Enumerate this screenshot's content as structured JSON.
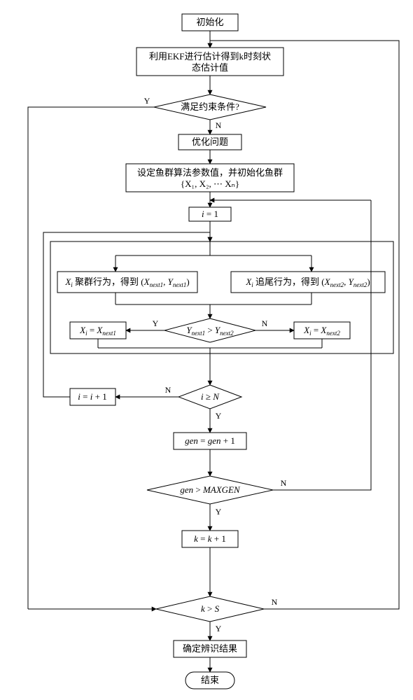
{
  "nodes": {
    "init": "初始化",
    "ekf_l1": "利用EKF进行估计得到k时刻状",
    "ekf_l2": "态估计值",
    "cond_constraint": "满足约束条件?",
    "opt": "优化问题",
    "fish_l1": "设定鱼群算法参数值，并初始化鱼群",
    "i1": "i = 1",
    "swarm_prefix": "X",
    "swarm_text": " 聚群行为，得到 ",
    "follow_text": " 追尾行为，得到 ",
    "xi_next1": "X",
    "xi_next2": "X",
    "gen_label": "gen = gen + 1",
    "gen_cond": "gen > MAXGEN",
    "k_inc": "k = k + 1",
    "k_cond": "k > S",
    "result": "确定辨识结果",
    "end": "结束",
    "i_inc": "i = i + 1",
    "i_cond": "i ≥ N",
    "y_cond": "Y",
    "Y": "Y",
    "N": "N"
  },
  "fish_set": "{X₁, X₂, ⋯ Xₙ}",
  "pair1": "(X",
  "pair_next1_sub": "next1",
  "pair_next2_sub": "next2",
  "y_next1": "Y",
  "y_next2": "Y"
}
